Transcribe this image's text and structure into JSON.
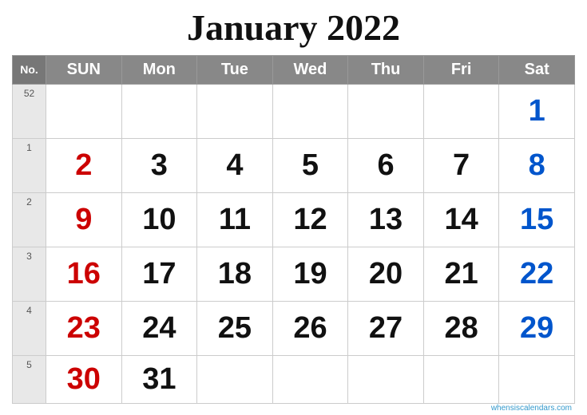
{
  "title": "January 2022",
  "header": {
    "no_label": "No.",
    "days": [
      "SUN",
      "Mon",
      "Tue",
      "Wed",
      "Thu",
      "Fri",
      "Sat"
    ]
  },
  "weeks": [
    {
      "week_num": "52",
      "days": [
        {
          "num": "",
          "color": ""
        },
        {
          "num": "",
          "color": ""
        },
        {
          "num": "",
          "color": ""
        },
        {
          "num": "",
          "color": ""
        },
        {
          "num": "",
          "color": ""
        },
        {
          "num": "",
          "color": ""
        },
        {
          "num": "1",
          "color": "blue"
        }
      ]
    },
    {
      "week_num": "1",
      "days": [
        {
          "num": "2",
          "color": "red"
        },
        {
          "num": "3",
          "color": "black"
        },
        {
          "num": "4",
          "color": "black"
        },
        {
          "num": "5",
          "color": "black"
        },
        {
          "num": "6",
          "color": "black"
        },
        {
          "num": "7",
          "color": "black"
        },
        {
          "num": "8",
          "color": "blue"
        }
      ]
    },
    {
      "week_num": "2",
      "days": [
        {
          "num": "9",
          "color": "red"
        },
        {
          "num": "10",
          "color": "black"
        },
        {
          "num": "11",
          "color": "black"
        },
        {
          "num": "12",
          "color": "black"
        },
        {
          "num": "13",
          "color": "black"
        },
        {
          "num": "14",
          "color": "black"
        },
        {
          "num": "15",
          "color": "blue"
        }
      ]
    },
    {
      "week_num": "3",
      "days": [
        {
          "num": "16",
          "color": "red"
        },
        {
          "num": "17",
          "color": "black"
        },
        {
          "num": "18",
          "color": "black"
        },
        {
          "num": "19",
          "color": "black"
        },
        {
          "num": "20",
          "color": "black"
        },
        {
          "num": "21",
          "color": "black"
        },
        {
          "num": "22",
          "color": "blue"
        }
      ]
    },
    {
      "week_num": "4",
      "days": [
        {
          "num": "23",
          "color": "red"
        },
        {
          "num": "24",
          "color": "black"
        },
        {
          "num": "25",
          "color": "black"
        },
        {
          "num": "26",
          "color": "black"
        },
        {
          "num": "27",
          "color": "black"
        },
        {
          "num": "28",
          "color": "black"
        },
        {
          "num": "29",
          "color": "blue"
        }
      ]
    },
    {
      "week_num": "5",
      "days": [
        {
          "num": "30",
          "color": "red"
        },
        {
          "num": "31",
          "color": "black"
        },
        {
          "num": "",
          "color": ""
        },
        {
          "num": "",
          "color": ""
        },
        {
          "num": "",
          "color": ""
        },
        {
          "num": "",
          "color": ""
        },
        {
          "num": "",
          "color": ""
        }
      ]
    }
  ],
  "watermark": "whensiscalendars.com"
}
